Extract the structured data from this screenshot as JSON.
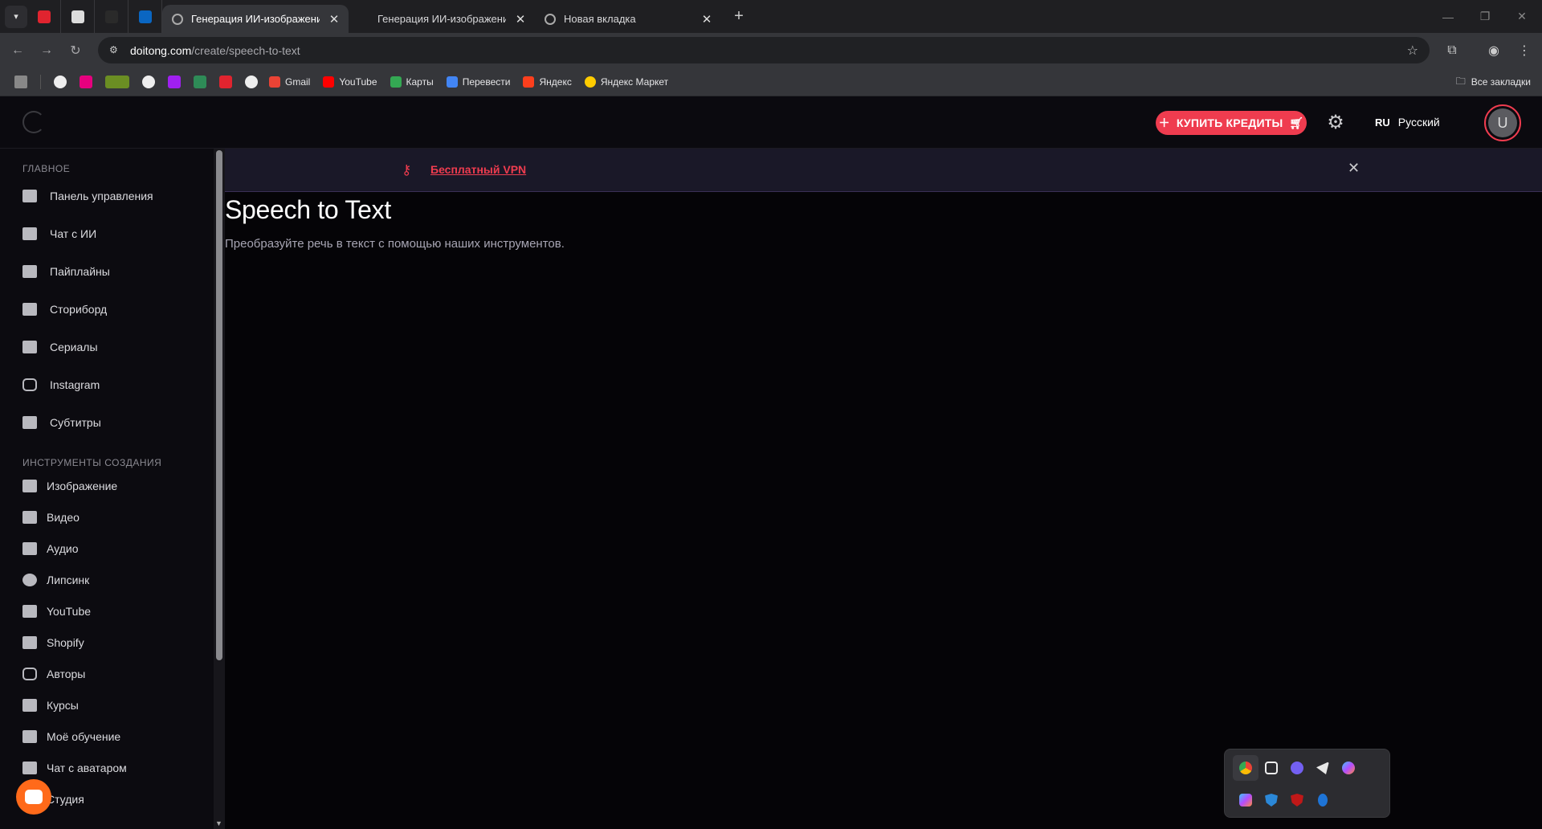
{
  "browser": {
    "tabs": [
      {
        "title": "Генерация ИИ-изображений с",
        "active": true
      },
      {
        "title": "Генерация ИИ-изображений с",
        "active": false
      },
      {
        "title": "Новая вкладка",
        "active": false
      }
    ],
    "new_tab_icon": "+",
    "url_host": "doitong.com",
    "url_path": "/create/speech-to-text",
    "bookmarks": [
      {
        "label": "Gmail",
        "color": "#ea4335"
      },
      {
        "label": "YouTube",
        "color": "#ff0000"
      },
      {
        "label": "Карты",
        "color": "#34a853"
      },
      {
        "label": "Перевести",
        "color": "#4285f4"
      },
      {
        "label": "Яндекс",
        "color": "#fc3f1d"
      },
      {
        "label": "Яндекс Маркет",
        "color": "#ffcc00"
      }
    ],
    "all_bookmarks": "Все закладки"
  },
  "header": {
    "buy_credits": "КУПИТЬ КРЕДИТЫ",
    "lang_code": "RU",
    "lang_name": "Русский",
    "avatar_letter": "U"
  },
  "sidebar": {
    "section_main": "ГЛАВНОЕ",
    "main_items": [
      {
        "label": "Панель управления",
        "icon": "dashboard-icon"
      },
      {
        "label": "Чат с ИИ",
        "icon": "chat-icon"
      },
      {
        "label": "Пайплайны",
        "icon": "pipeline-icon"
      },
      {
        "label": "Сториборд",
        "icon": "storyboard-icon"
      },
      {
        "label": "Сериалы",
        "icon": "film-icon"
      },
      {
        "label": "Instagram",
        "icon": "instagram-icon"
      },
      {
        "label": "Субтитры",
        "icon": "subtitles-icon"
      }
    ],
    "section_tools": "ИНСТРУМЕНТЫ СОЗДАНИЯ",
    "tool_items": [
      {
        "label": "Изображение",
        "icon": "image-icon"
      },
      {
        "label": "Видео",
        "icon": "video-icon"
      },
      {
        "label": "Аудио",
        "icon": "audio-icon"
      },
      {
        "label": "Липсинк",
        "icon": "lipsync-icon"
      },
      {
        "label": "YouTube",
        "icon": "youtube-icon"
      },
      {
        "label": "Shopify",
        "icon": "cart-icon"
      },
      {
        "label": "Авторы",
        "icon": "briefcase-icon"
      },
      {
        "label": "Курсы",
        "icon": "school-icon"
      },
      {
        "label": "Моё обучение",
        "icon": "book-icon"
      },
      {
        "label": "Чат с аватаром",
        "icon": "chat-icon"
      },
      {
        "label": "Студия",
        "icon": "studio-icon"
      }
    ]
  },
  "banner": {
    "link": "Бесплатный VPN",
    "close": "✕"
  },
  "main": {
    "title": "Speech to Text",
    "subtitle": "Преобразуйте речь в текст с помощью наших инструментов."
  },
  "colors": {
    "accent": "#ef3c4f",
    "background": "#050407",
    "sidebar": "#0c0b10"
  }
}
